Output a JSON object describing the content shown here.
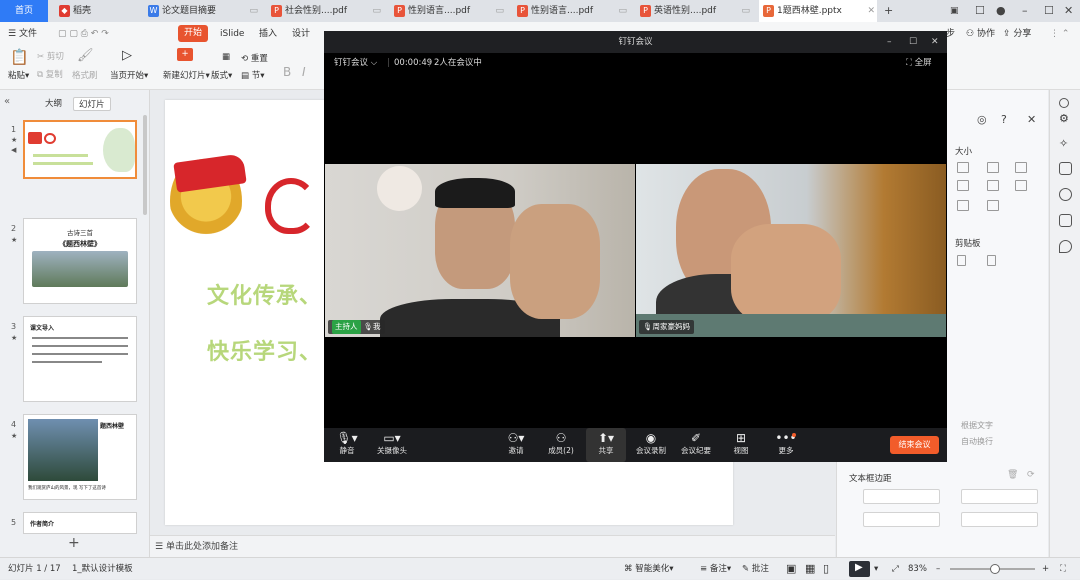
{
  "tabs": [
    {
      "label": "首页",
      "icon": "home-tab"
    },
    {
      "label": "稻壳",
      "icon": "docer-icon"
    },
    {
      "label": "论文题目摘要",
      "icon": "word-doc-icon"
    },
    {
      "label": "社会性别....pdf",
      "icon": "pdf-icon"
    },
    {
      "label": "性别语言....pdf",
      "icon": "pdf-icon"
    },
    {
      "label": "性别语言....pdf",
      "icon": "pdf-icon"
    },
    {
      "label": "英语性别....pdf",
      "icon": "pdf-icon"
    },
    {
      "label": "1题西林壁.pptx",
      "icon": "pptx-icon"
    }
  ],
  "menu": {
    "file": "文件",
    "start": "开始",
    "islide": "iSlide",
    "insert": "插入",
    "design": "设计",
    "right_items": [
      "步",
      "协作",
      "分享"
    ]
  },
  "ribbon": {
    "paste": "粘贴",
    "cut": "剪切",
    "copy": "复制",
    "format_painter": "格式刷",
    "start_from_current": "当页开始",
    "new_slide": "新建幻灯片",
    "layout": "版式",
    "section": "节",
    "reset": "重置"
  },
  "left_panel": {
    "tab_outline": "大纲",
    "tab_slides": "幻灯片",
    "slide_numbers": [
      "1",
      "2",
      "3",
      "4",
      "5"
    ],
    "thumbs": {
      "s2_title": "古诗三首",
      "s2_sub": "《题西林壁》",
      "s3_title": "课文导入",
      "s4_title": "题西林壁",
      "s4_caption": "我们观赏庐山的风景，现 写下了这首诗",
      "s5_title": "作者简介"
    }
  },
  "slide": {
    "line1": "文化传承、",
    "line2": "快乐学习、"
  },
  "notes_placeholder": "单击此处添加备注",
  "meeting": {
    "window_title": "钉钉会议",
    "app_name": "钉钉会议",
    "duration": "00:00:49",
    "participants_text": "2人在会议中",
    "fullscreen": "全屏",
    "video_left": {
      "host_tag": "主持人",
      "name": "我"
    },
    "video_right": {
      "name": "周家豪妈妈"
    },
    "toolbar": [
      {
        "label": "静音",
        "icon": "microphone-icon"
      },
      {
        "label": "关摄像头",
        "icon": "camera-icon"
      },
      {
        "label": "邀请",
        "icon": "invite-icon"
      },
      {
        "label": "成员(2)",
        "icon": "members-icon"
      },
      {
        "label": "共享",
        "icon": "share-screen-icon"
      },
      {
        "label": "会议录制",
        "icon": "record-icon"
      },
      {
        "label": "会议纪要",
        "icon": "minutes-icon"
      },
      {
        "label": "视图",
        "icon": "grid-view-icon"
      },
      {
        "label": "更多",
        "icon": "more-icon"
      }
    ],
    "end_button": "结束会议"
  },
  "right_pane": {
    "size_label": "大小",
    "clipboard_label": "剪贴板",
    "text_label_1": "根据文字",
    "text_label_2": "自动换行",
    "margin_label": "文本框边距"
  },
  "status": {
    "slide_indicator": "幻灯片 1 / 17",
    "template": "1_默认设计模板",
    "smart_beautify": "智能美化",
    "notes": "备注",
    "comments": "批注",
    "zoom": "83%"
  },
  "colors": {
    "wps_home": "#2f7bf6",
    "start_tab": "#e8542f",
    "end_meeting": "#f25c2a",
    "host_green": "#2ba245",
    "slide_text": "#b7d77b"
  }
}
